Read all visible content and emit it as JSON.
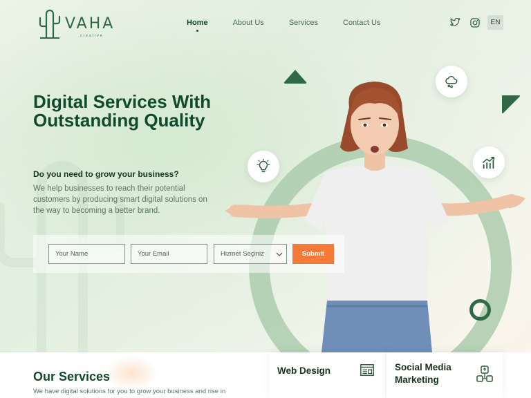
{
  "brand": {
    "name": "VAHA",
    "tagline": "creative"
  },
  "nav": {
    "items": [
      {
        "label": "Home",
        "active": true
      },
      {
        "label": "About Us",
        "active": false
      },
      {
        "label": "Services",
        "active": false
      },
      {
        "label": "Contact Us",
        "active": false
      }
    ]
  },
  "social": {
    "icons": [
      "twitter-icon",
      "instagram-icon"
    ]
  },
  "language": "EN",
  "hero": {
    "headline": "Digital Services With Outstanding Quality",
    "question": "Do you need to grow your business?",
    "description": "We help businesses to reach their potential customers by producing smart digital solutions on the way to becoming a better brand."
  },
  "form": {
    "name_placeholder": "Your Name",
    "email_placeholder": "Your Email",
    "service_select": "Hizmet Seçiniz",
    "submit_label": "Submit"
  },
  "floating_icons": [
    "cloud-icon",
    "lightbulb-icon",
    "growth-chart-icon"
  ],
  "services": {
    "title": "Our Services",
    "description": "We have digital solutions for you to grow your business and rise in",
    "cards": [
      {
        "title": "Web Design",
        "icon": "web-design-icon"
      },
      {
        "title": "Social Media Marketing",
        "icon": "social-media-icon"
      }
    ]
  },
  "colors": {
    "primary_green": "#0f4a2c",
    "accent_orange": "#f47a3a",
    "ring_green": "#abcbae"
  }
}
